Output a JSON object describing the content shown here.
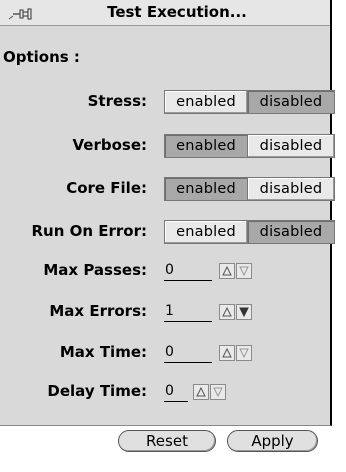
{
  "window": {
    "title": "Test Execution..."
  },
  "options": {
    "header": "Options :",
    "toggles": [
      {
        "label": "Stress:",
        "enabled_label": "enabled",
        "disabled_label": "disabled",
        "selected": "disabled"
      },
      {
        "label": "Verbose:",
        "enabled_label": "enabled",
        "disabled_label": "disabled",
        "selected": "enabled"
      },
      {
        "label": "Core File:",
        "enabled_label": "enabled",
        "disabled_label": "disabled",
        "selected": "enabled"
      },
      {
        "label": "Run On Error:",
        "enabled_label": "enabled",
        "disabled_label": "disabled",
        "selected": "disabled"
      }
    ],
    "numeric": [
      {
        "label": "Max Passes:",
        "value": "0"
      },
      {
        "label": "Max Errors:",
        "value": "1"
      },
      {
        "label": "Max Time:",
        "value": "0"
      },
      {
        "label": "Delay Time:",
        "value": "0"
      }
    ]
  },
  "buttons": {
    "reset": "Reset",
    "apply": "Apply"
  },
  "icons": {
    "pin": "pushpin-icon",
    "increment": "arrow-up-icon",
    "decrement": "arrow-down-icon"
  }
}
